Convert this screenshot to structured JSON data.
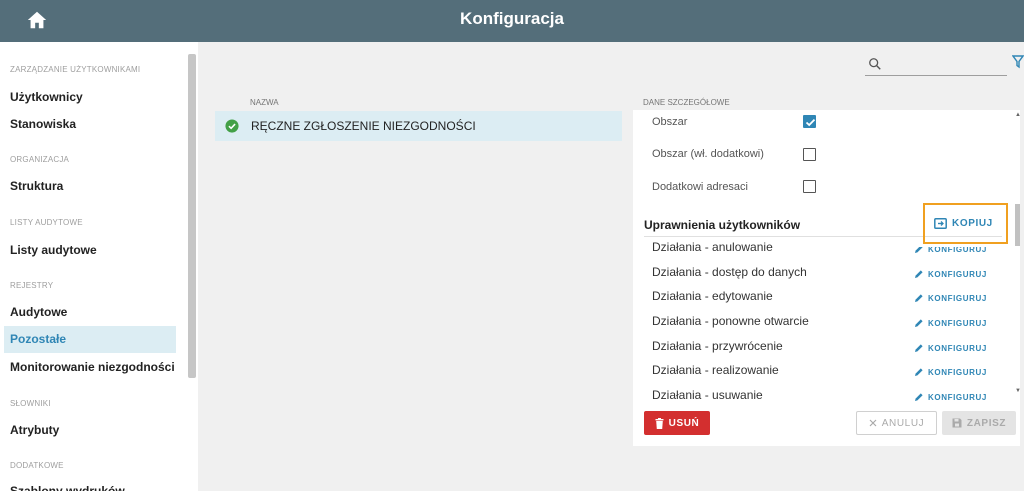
{
  "header": {
    "title": "Konfiguracja"
  },
  "sidebar": {
    "sections": [
      {
        "label": "ZARZĄDZANIE UŻYTKOWNIKAMI"
      },
      {
        "label": "ORGANIZACJA"
      },
      {
        "label": "LISTY AUDYTOWE"
      },
      {
        "label": "REJESTRY"
      },
      {
        "label": "SŁOWNIKI"
      },
      {
        "label": "DODATKOWE"
      }
    ],
    "items": [
      {
        "label": "Użytkownicy"
      },
      {
        "label": "Stanowiska"
      },
      {
        "label": "Struktura"
      },
      {
        "label": "Listy audytowe"
      },
      {
        "label": "Audytowe"
      },
      {
        "label": "Pozostałe",
        "active": true
      },
      {
        "label": "Monitorowanie niezgodności"
      },
      {
        "label": "Atrybuty"
      },
      {
        "label": "Szablony wydruków"
      }
    ]
  },
  "search": {
    "placeholder": "",
    "value": ""
  },
  "list": {
    "header": "NAZWA",
    "rows": [
      {
        "label": "RĘCZNE ZGŁOSZENIE NIEZGODNOŚCI",
        "status": "active"
      }
    ]
  },
  "details": {
    "header": "DANE SZCZEGÓŁOWE",
    "fields": [
      {
        "label": "Obszar",
        "checked": true
      },
      {
        "label": "Obszar (wł. dodatkowi)",
        "checked": false
      },
      {
        "label": "Dodatkowi adresaci",
        "checked": false
      }
    ],
    "permissions_title": "Uprawnienia użytkowników",
    "copy_label": "KOPIUJ",
    "configure_label": "KONFIGURUJ",
    "permissions": [
      {
        "label": "Działania - anulowanie"
      },
      {
        "label": "Działania - dostęp do danych"
      },
      {
        "label": "Działania - edytowanie"
      },
      {
        "label": "Działania - ponowne otwarcie"
      },
      {
        "label": "Działania - przywrócenie"
      },
      {
        "label": "Działania - realizowanie"
      },
      {
        "label": "Działania - usuwanie"
      }
    ]
  },
  "actions": {
    "delete_label": "USUŃ",
    "cancel_label": "ANULUJ",
    "save_label": "ZAPISZ"
  },
  "colors": {
    "header_bg": "#546e7a",
    "accent": "#2f86b5",
    "danger": "#d32f2f",
    "highlight": "#f0a020",
    "success": "#43a047"
  },
  "icons": [
    "home-icon",
    "search-icon",
    "filter-icon",
    "check-circle-icon",
    "copy-icon",
    "pencil-icon",
    "trash-icon",
    "close-icon",
    "save-icon",
    "checkmark-icon"
  ]
}
